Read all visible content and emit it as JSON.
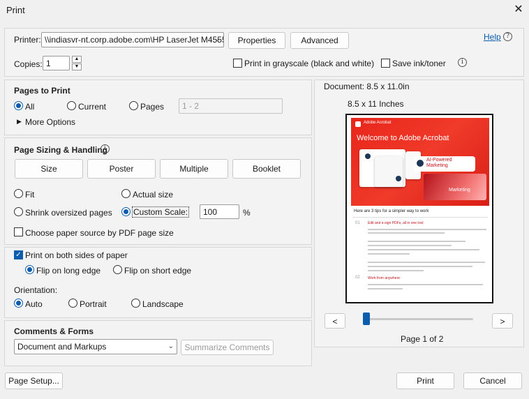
{
  "window": {
    "title": "Print"
  },
  "printer": {
    "label": "Printer:",
    "selected": "\\\\indiasvr-nt.corp.adobe.com\\HP LaserJet M4555",
    "properties_label": "Properties",
    "advanced_label": "Advanced",
    "help_label": "Help",
    "copies_label": "Copies:",
    "copies_value": "1",
    "grayscale_label": "Print in grayscale (black and white)",
    "save_ink_label": "Save ink/toner"
  },
  "pages_to_print": {
    "heading": "Pages to Print",
    "all_label": "All",
    "current_label": "Current",
    "pages_label": "Pages",
    "pages_placeholder": "1 - 2",
    "more_options_label": "More Options"
  },
  "sizing": {
    "heading": "Page Sizing & Handling",
    "tabs": [
      "Size",
      "Poster",
      "Multiple",
      "Booklet"
    ],
    "fit_label": "Fit",
    "actual_size_label": "Actual size",
    "shrink_label": "Shrink oversized pages",
    "custom_scale_label": "Custom Scale:",
    "custom_scale_value": "100",
    "percent": "%",
    "paper_source_label": "Choose paper source by PDF page size"
  },
  "duplex": {
    "both_sides_label": "Print on both sides of paper",
    "long_edge_label": "Flip on long edge",
    "short_edge_label": "Flip on short edge"
  },
  "orientation": {
    "heading": "Orientation:",
    "auto_label": "Auto",
    "portrait_label": "Portrait",
    "landscape_label": "Landscape"
  },
  "comments": {
    "heading": "Comments & Forms",
    "selected": "Document and Markups",
    "summarize_label": "Summarize Comments"
  },
  "preview": {
    "document_size": "Document: 8.5 x 11.0in",
    "paper_size": "8.5 x 11 Inches",
    "page_indicator": "Page 1 of 2",
    "prev_label": "<",
    "next_label": ">",
    "page_fraction": 0,
    "thumb": {
      "brand": "Adobe Acrobat",
      "headline": "Welcome to Adobe Acrobat",
      "badge": "AI-Powered Marketing",
      "tag": "Marketing",
      "intro": "Here are 3 tips for a simpler way to work",
      "tip1_num": "01",
      "tip1_title": "Edit and e-sign PDFs, all in one tool",
      "tip2_num": "02",
      "tip2_title": "Work from anywhere"
    }
  },
  "footer": {
    "page_setup_label": "Page Setup...",
    "print_label": "Print",
    "cancel_label": "Cancel"
  },
  "colors": {
    "accent": "#0b5cad",
    "acrobat_red": "#e0251b"
  }
}
